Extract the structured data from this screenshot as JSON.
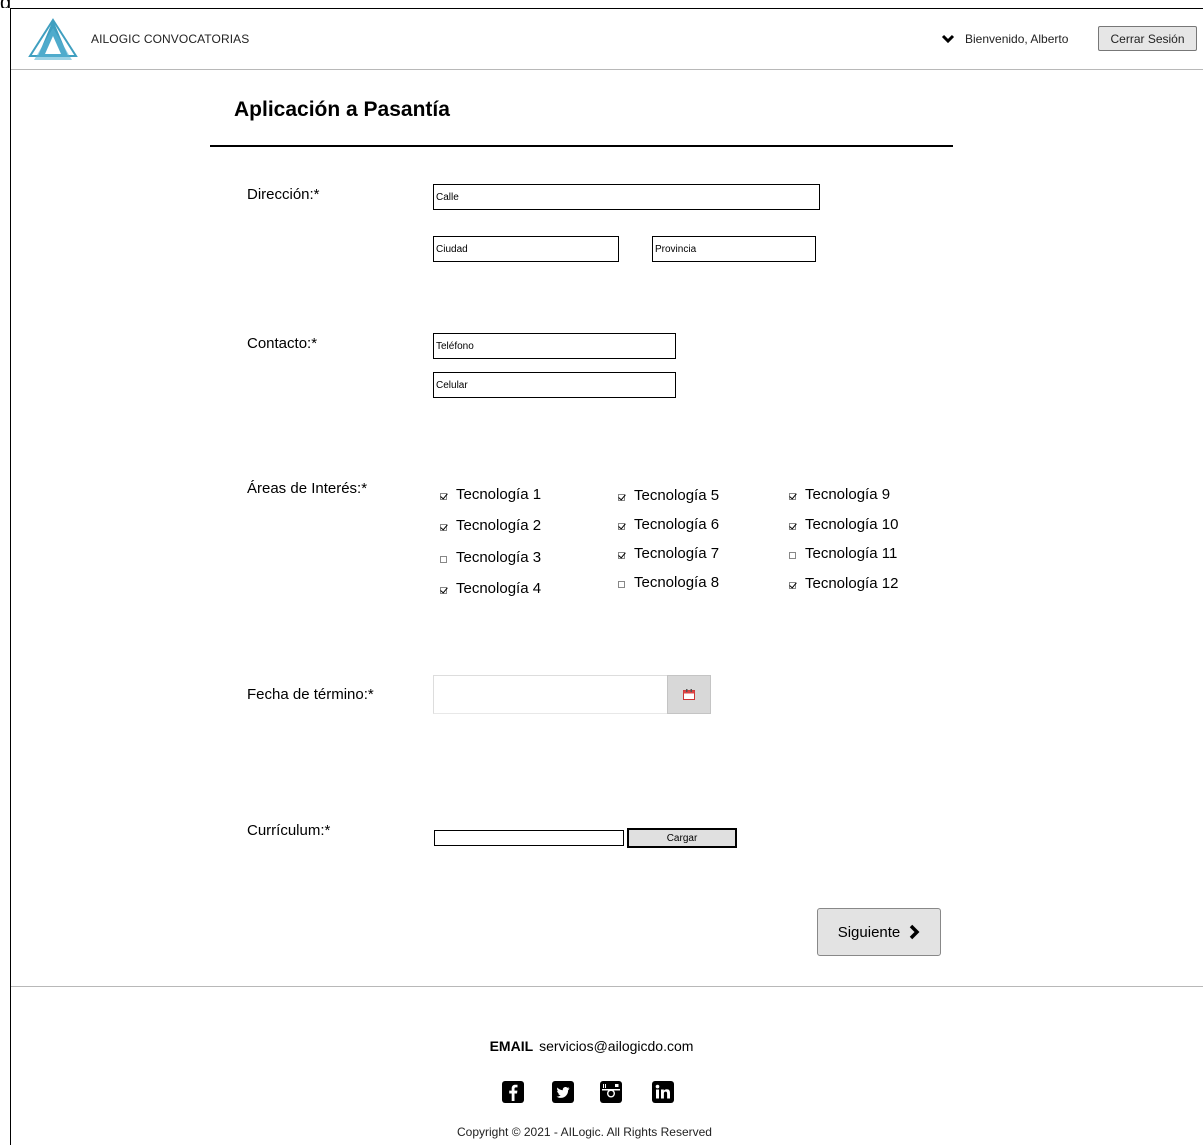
{
  "header": {
    "app_name": "AILOGIC CONVOCATORIAS",
    "welcome": "Bienvenido, Alberto",
    "logout_label": "Cerrar Sesión"
  },
  "page": {
    "title": "Aplicación a Pasantía"
  },
  "address": {
    "label": "Dirección:*",
    "street_placeholder": "Calle",
    "city_placeholder": "Ciudad",
    "province_placeholder": "Provincia"
  },
  "contact": {
    "label": "Contacto:*",
    "phone_placeholder": "Teléfono",
    "mobile_placeholder": "Celular"
  },
  "interests": {
    "label": "Áreas de Interés:*",
    "items": [
      {
        "label": "Tecnología 1",
        "checked": true
      },
      {
        "label": "Tecnología 2",
        "checked": true
      },
      {
        "label": "Tecnología 3",
        "checked": false
      },
      {
        "label": "Tecnología 4",
        "checked": true
      },
      {
        "label": "Tecnología 5",
        "checked": true
      },
      {
        "label": "Tecnología 6",
        "checked": true
      },
      {
        "label": "Tecnología 7",
        "checked": true
      },
      {
        "label": "Tecnología 8",
        "checked": false
      },
      {
        "label": "Tecnología 9",
        "checked": true
      },
      {
        "label": "Tecnología 10",
        "checked": true
      },
      {
        "label": "Tecnología 11",
        "checked": false
      },
      {
        "label": "Tecnología 12",
        "checked": true
      }
    ]
  },
  "end_date": {
    "label": "Fecha de término:*",
    "icon": "calendar-icon"
  },
  "curriculum": {
    "label": "Currículum:*",
    "upload_label": "Cargar"
  },
  "actions": {
    "next_label": "Siguiente"
  },
  "footer": {
    "email_label": "EMAIL",
    "email": "servicios@ailogicdo.com",
    "social": [
      "facebook-icon",
      "twitter-icon",
      "instagram-icon",
      "linkedin-icon"
    ],
    "copyright": "Copyright © 2021 - AILogic. All Rights Reserved"
  },
  "colors": {
    "logo_teal": "#3f9fc0",
    "button_gray": "#e3e3e3"
  }
}
